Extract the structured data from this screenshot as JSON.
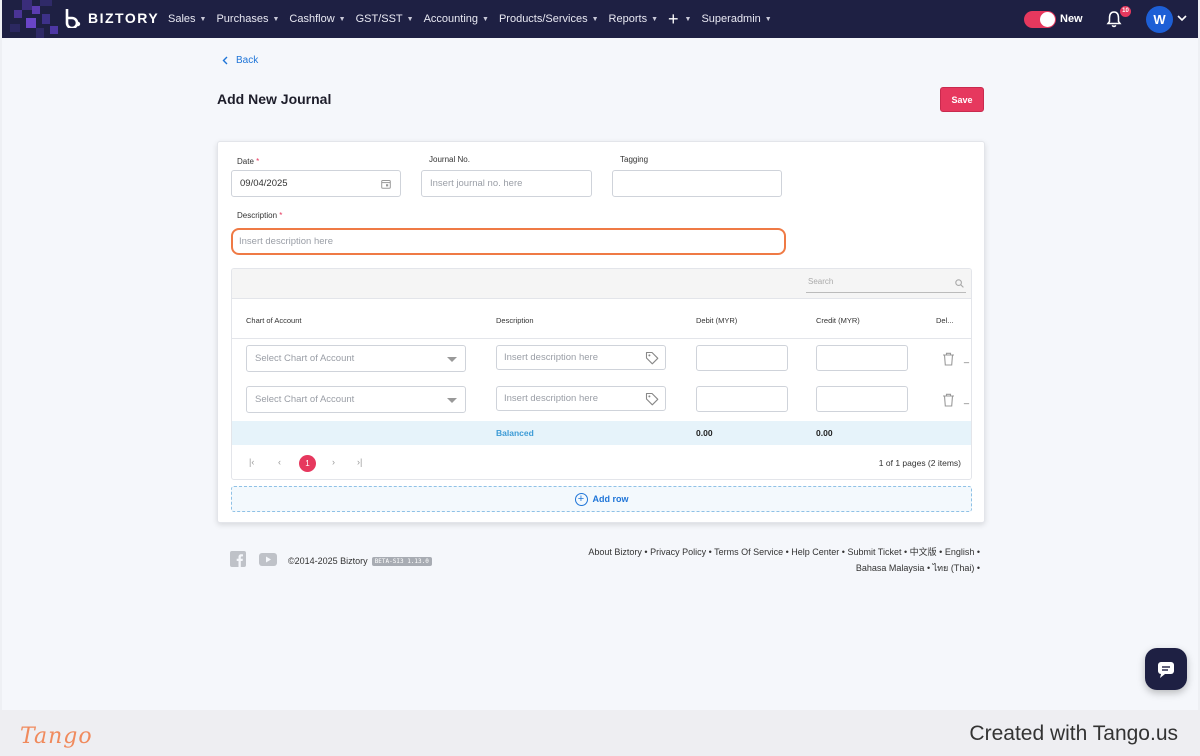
{
  "brand": {
    "name": "BIZTORY"
  },
  "nav": {
    "menu": [
      "Sales",
      "Purchases",
      "Cashflow",
      "GST/SST",
      "Accounting",
      "Products/Services",
      "Reports"
    ],
    "superadmin": "Superadmin",
    "toggle_label": "New",
    "notification_count": "10",
    "avatar_initial": "W"
  },
  "page": {
    "back_label": "Back",
    "title": "Add New Journal",
    "save_label": "Save"
  },
  "form": {
    "date_label": "Date",
    "date_value": "09/04/2025",
    "journal_no_label": "Journal No.",
    "journal_no_placeholder": "Insert journal no. here",
    "tagging_label": "Tagging",
    "description_label": "Description",
    "description_placeholder": "Insert description here",
    "required_mark": "*"
  },
  "grid": {
    "search_placeholder": "Search",
    "columns": [
      "Chart of Account",
      "Description",
      "Debit (MYR)",
      "Credit (MYR)",
      "Del..."
    ],
    "rows": [
      {
        "account_placeholder": "Select Chart of Account",
        "description_placeholder": "Insert description here",
        "trail": "_"
      },
      {
        "account_placeholder": "Select Chart of Account",
        "description_placeholder": "Insert description here",
        "trail": "_"
      }
    ],
    "balance_status": "Balanced",
    "debit_total": "0.00",
    "credit_total": "0.00",
    "pager": {
      "first": "|‹",
      "prev": "‹",
      "current": "1",
      "next": "›",
      "last": "›|",
      "info": "1 of 1 pages (2 items)"
    },
    "add_row_label": "Add row"
  },
  "footer": {
    "copyright": "©2014-2025 Biztory",
    "version_badge": "BETA-SI3 1.13.0",
    "links_line1": [
      "About Biztory",
      "Privacy Policy",
      "Terms Of Service",
      "Help Center",
      "Submit Ticket",
      "中文版",
      "English"
    ],
    "links_line2": [
      "Bahasa Malaysia",
      "ไทย (Thai)"
    ]
  },
  "tango": {
    "logo": "Tango",
    "credit": "Created with Tango.us"
  },
  "colors": {
    "nav_bg": "#1e2043",
    "accent": "#e6385e",
    "link": "#1f75d8",
    "highlight": "#ef7a45"
  }
}
